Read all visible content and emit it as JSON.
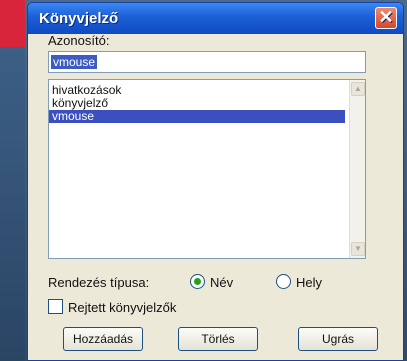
{
  "window": {
    "title": "Könyvjelző",
    "close_glyph": "✕"
  },
  "identifier": {
    "label": "Azonosító:",
    "value": "vmouse"
  },
  "bookmarks": {
    "items": [
      {
        "label": "hivatkozások",
        "selected": false
      },
      {
        "label": "könyvjelző",
        "selected": false
      },
      {
        "label": "vmouse",
        "selected": true
      }
    ]
  },
  "sort": {
    "label": "Rendezés típusa:",
    "option_name": "Név",
    "option_place": "Hely",
    "selected": "Név"
  },
  "hidden": {
    "label": "Rejtett könyvjelzők",
    "checked": false
  },
  "buttons": {
    "add": "Hozzáadás",
    "delete": "Törlés",
    "goto": "Ugrás"
  },
  "icons": {
    "close": "close-icon",
    "scroll_up": "chevron-up-icon",
    "scroll_down": "chevron-down-icon"
  },
  "colors": {
    "titlebar": "#1c5fd6",
    "selection": "#3c4fc0",
    "radio_dot": "#21a121",
    "accent_red": "#d8253b"
  }
}
